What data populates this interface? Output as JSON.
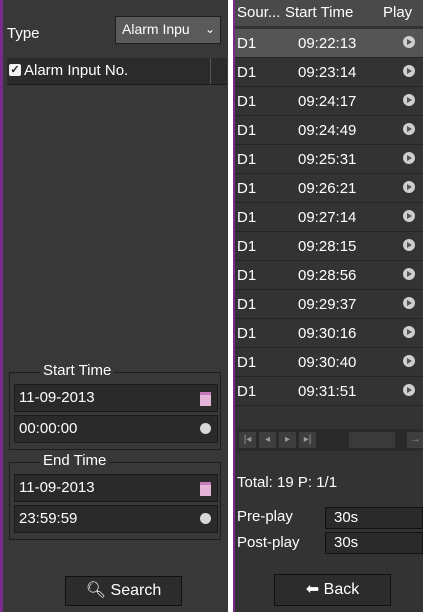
{
  "filter": {
    "type_label": "Type",
    "type_value": "Alarm Inpu",
    "channel_header": "Alarm Input No.",
    "start_time": {
      "title": "Start Time",
      "date": "11-09-2013",
      "time": "00:00:00"
    },
    "end_time": {
      "title": "End Time",
      "date": "11-09-2013",
      "time": "23:59:59"
    },
    "search_label": "Search"
  },
  "results": {
    "columns": [
      "Sour...",
      "Start Time",
      "Play"
    ],
    "rows": [
      {
        "source": "D1",
        "start": "09:22:13",
        "selected": true
      },
      {
        "source": "D1",
        "start": "09:23:14"
      },
      {
        "source": "D1",
        "start": "09:24:17"
      },
      {
        "source": "D1",
        "start": "09:24:49"
      },
      {
        "source": "D1",
        "start": "09:25:31"
      },
      {
        "source": "D1",
        "start": "09:26:21"
      },
      {
        "source": "D1",
        "start": "09:27:14"
      },
      {
        "source": "D1",
        "start": "09:28:15"
      },
      {
        "source": "D1",
        "start": "09:28:56"
      },
      {
        "source": "D1",
        "start": "09:29:37"
      },
      {
        "source": "D1",
        "start": "09:30:16"
      },
      {
        "source": "D1",
        "start": "09:30:40"
      },
      {
        "source": "D1",
        "start": "09:31:51"
      }
    ],
    "total_text": "Total: 19  P: 1/1",
    "pre_play_label": "Pre-play",
    "pre_play_value": "30s",
    "post_play_label": "Post-play",
    "post_play_value": "30s",
    "back_label": "Back"
  },
  "colors": {
    "accent_border": "#7a2a8c",
    "panel": "#383838",
    "row_selected": "#555555"
  }
}
